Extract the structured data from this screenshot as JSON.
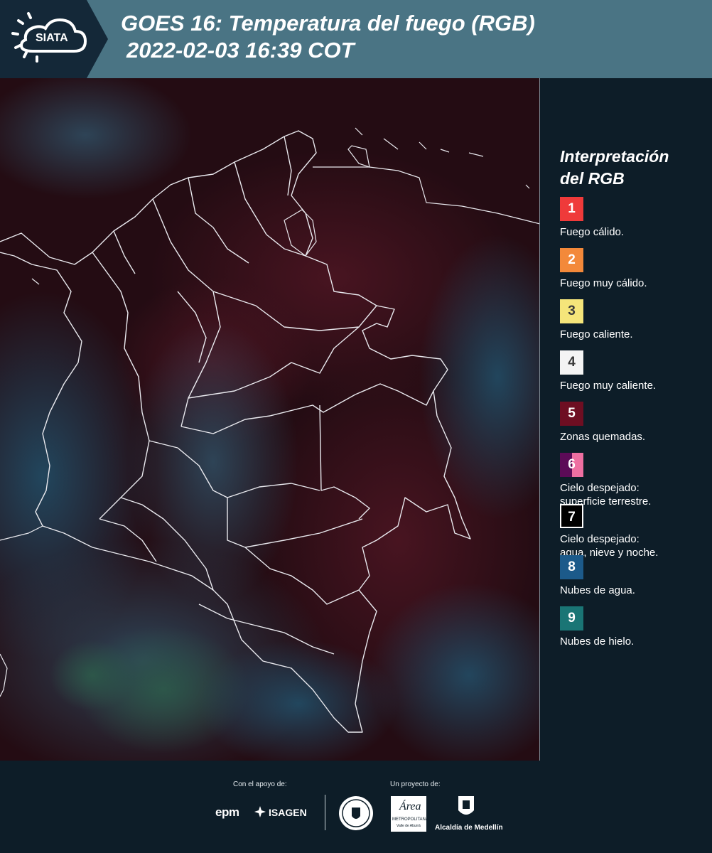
{
  "header": {
    "logo_text": "SIATA",
    "title_line1": "GOES 16: Temperatura del fuego (RGB)",
    "title_line2": "2022-02-03 16:39 COT",
    "background_color": "#4a7484"
  },
  "legend": {
    "title_line1": "Interpretación",
    "title_line2": "del RGB",
    "items": [
      {
        "number": "1",
        "label": "Fuego cálido.",
        "color": "#ef3a3a"
      },
      {
        "number": "2",
        "label": "Fuego muy cálido.",
        "color": "#f3893a"
      },
      {
        "number": "3",
        "label": "Fuego caliente.",
        "color": "#f5e57a"
      },
      {
        "number": "4",
        "label": "Fuego muy caliente.",
        "color": "#f4f4f4"
      },
      {
        "number": "5",
        "label": "Zonas quemadas.",
        "color": "#6e0e22"
      },
      {
        "number": "6",
        "label_line1": "Cielo despejado:",
        "label_line2": "superficie terrestre.",
        "color_a": "#5c0b57",
        "color_b": "#ee6fa1"
      },
      {
        "number": "7",
        "label_line1": "Cielo despejado:",
        "label_line2": "agua, nieve y noche.",
        "color": "#000000"
      },
      {
        "number": "8",
        "label": "Nubes de agua.",
        "color": "#1c5a8a"
      },
      {
        "number": "9",
        "label": "Nubes de hielo.",
        "color": "#1a7575"
      }
    ]
  },
  "footer": {
    "support_label": "Con el apoyo de:",
    "project_label": "Un proyecto de:",
    "sponsor1": "epm",
    "sponsor2": "ISAGEN",
    "org_area_line1": "Área",
    "org_area_line2": "METROPOLITANA",
    "org_area_line3": "Valle de Aburrá",
    "org_alcaldia": "Alcaldía de Medellín"
  }
}
